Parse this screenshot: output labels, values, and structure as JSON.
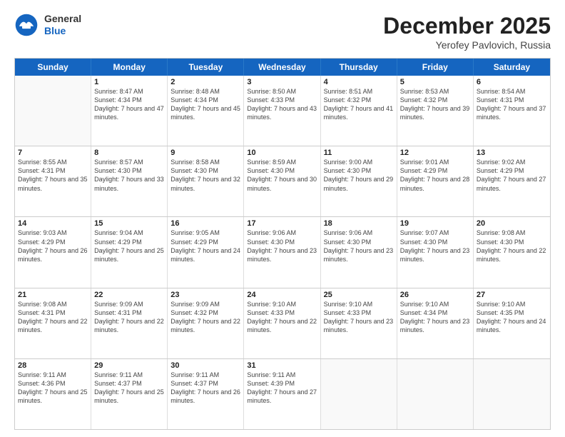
{
  "header": {
    "logo": {
      "general": "General",
      "blue": "Blue"
    },
    "title": "December 2025",
    "location": "Yerofey Pavlovich, Russia"
  },
  "dayHeaders": [
    "Sunday",
    "Monday",
    "Tuesday",
    "Wednesday",
    "Thursday",
    "Friday",
    "Saturday"
  ],
  "weeks": [
    [
      {
        "day": "",
        "empty": true
      },
      {
        "day": "1",
        "sunrise": "Sunrise: 8:47 AM",
        "sunset": "Sunset: 4:34 PM",
        "daylight": "Daylight: 7 hours and 47 minutes."
      },
      {
        "day": "2",
        "sunrise": "Sunrise: 8:48 AM",
        "sunset": "Sunset: 4:34 PM",
        "daylight": "Daylight: 7 hours and 45 minutes."
      },
      {
        "day": "3",
        "sunrise": "Sunrise: 8:50 AM",
        "sunset": "Sunset: 4:33 PM",
        "daylight": "Daylight: 7 hours and 43 minutes."
      },
      {
        "day": "4",
        "sunrise": "Sunrise: 8:51 AM",
        "sunset": "Sunset: 4:32 PM",
        "daylight": "Daylight: 7 hours and 41 minutes."
      },
      {
        "day": "5",
        "sunrise": "Sunrise: 8:53 AM",
        "sunset": "Sunset: 4:32 PM",
        "daylight": "Daylight: 7 hours and 39 minutes."
      },
      {
        "day": "6",
        "sunrise": "Sunrise: 8:54 AM",
        "sunset": "Sunset: 4:31 PM",
        "daylight": "Daylight: 7 hours and 37 minutes."
      }
    ],
    [
      {
        "day": "7",
        "sunrise": "Sunrise: 8:55 AM",
        "sunset": "Sunset: 4:31 PM",
        "daylight": "Daylight: 7 hours and 35 minutes."
      },
      {
        "day": "8",
        "sunrise": "Sunrise: 8:57 AM",
        "sunset": "Sunset: 4:30 PM",
        "daylight": "Daylight: 7 hours and 33 minutes."
      },
      {
        "day": "9",
        "sunrise": "Sunrise: 8:58 AM",
        "sunset": "Sunset: 4:30 PM",
        "daylight": "Daylight: 7 hours and 32 minutes."
      },
      {
        "day": "10",
        "sunrise": "Sunrise: 8:59 AM",
        "sunset": "Sunset: 4:30 PM",
        "daylight": "Daylight: 7 hours and 30 minutes."
      },
      {
        "day": "11",
        "sunrise": "Sunrise: 9:00 AM",
        "sunset": "Sunset: 4:30 PM",
        "daylight": "Daylight: 7 hours and 29 minutes."
      },
      {
        "day": "12",
        "sunrise": "Sunrise: 9:01 AM",
        "sunset": "Sunset: 4:29 PM",
        "daylight": "Daylight: 7 hours and 28 minutes."
      },
      {
        "day": "13",
        "sunrise": "Sunrise: 9:02 AM",
        "sunset": "Sunset: 4:29 PM",
        "daylight": "Daylight: 7 hours and 27 minutes."
      }
    ],
    [
      {
        "day": "14",
        "sunrise": "Sunrise: 9:03 AM",
        "sunset": "Sunset: 4:29 PM",
        "daylight": "Daylight: 7 hours and 26 minutes."
      },
      {
        "day": "15",
        "sunrise": "Sunrise: 9:04 AM",
        "sunset": "Sunset: 4:29 PM",
        "daylight": "Daylight: 7 hours and 25 minutes."
      },
      {
        "day": "16",
        "sunrise": "Sunrise: 9:05 AM",
        "sunset": "Sunset: 4:29 PM",
        "daylight": "Daylight: 7 hours and 24 minutes."
      },
      {
        "day": "17",
        "sunrise": "Sunrise: 9:06 AM",
        "sunset": "Sunset: 4:30 PM",
        "daylight": "Daylight: 7 hours and 23 minutes."
      },
      {
        "day": "18",
        "sunrise": "Sunrise: 9:06 AM",
        "sunset": "Sunset: 4:30 PM",
        "daylight": "Daylight: 7 hours and 23 minutes."
      },
      {
        "day": "19",
        "sunrise": "Sunrise: 9:07 AM",
        "sunset": "Sunset: 4:30 PM",
        "daylight": "Daylight: 7 hours and 23 minutes."
      },
      {
        "day": "20",
        "sunrise": "Sunrise: 9:08 AM",
        "sunset": "Sunset: 4:30 PM",
        "daylight": "Daylight: 7 hours and 22 minutes."
      }
    ],
    [
      {
        "day": "21",
        "sunrise": "Sunrise: 9:08 AM",
        "sunset": "Sunset: 4:31 PM",
        "daylight": "Daylight: 7 hours and 22 minutes."
      },
      {
        "day": "22",
        "sunrise": "Sunrise: 9:09 AM",
        "sunset": "Sunset: 4:31 PM",
        "daylight": "Daylight: 7 hours and 22 minutes."
      },
      {
        "day": "23",
        "sunrise": "Sunrise: 9:09 AM",
        "sunset": "Sunset: 4:32 PM",
        "daylight": "Daylight: 7 hours and 22 minutes."
      },
      {
        "day": "24",
        "sunrise": "Sunrise: 9:10 AM",
        "sunset": "Sunset: 4:33 PM",
        "daylight": "Daylight: 7 hours and 22 minutes."
      },
      {
        "day": "25",
        "sunrise": "Sunrise: 9:10 AM",
        "sunset": "Sunset: 4:33 PM",
        "daylight": "Daylight: 7 hours and 23 minutes."
      },
      {
        "day": "26",
        "sunrise": "Sunrise: 9:10 AM",
        "sunset": "Sunset: 4:34 PM",
        "daylight": "Daylight: 7 hours and 23 minutes."
      },
      {
        "day": "27",
        "sunrise": "Sunrise: 9:10 AM",
        "sunset": "Sunset: 4:35 PM",
        "daylight": "Daylight: 7 hours and 24 minutes."
      }
    ],
    [
      {
        "day": "28",
        "sunrise": "Sunrise: 9:11 AM",
        "sunset": "Sunset: 4:36 PM",
        "daylight": "Daylight: 7 hours and 25 minutes."
      },
      {
        "day": "29",
        "sunrise": "Sunrise: 9:11 AM",
        "sunset": "Sunset: 4:37 PM",
        "daylight": "Daylight: 7 hours and 25 minutes."
      },
      {
        "day": "30",
        "sunrise": "Sunrise: 9:11 AM",
        "sunset": "Sunset: 4:37 PM",
        "daylight": "Daylight: 7 hours and 26 minutes."
      },
      {
        "day": "31",
        "sunrise": "Sunrise: 9:11 AM",
        "sunset": "Sunset: 4:39 PM",
        "daylight": "Daylight: 7 hours and 27 minutes."
      },
      {
        "day": "",
        "empty": true
      },
      {
        "day": "",
        "empty": true
      },
      {
        "day": "",
        "empty": true
      }
    ]
  ]
}
